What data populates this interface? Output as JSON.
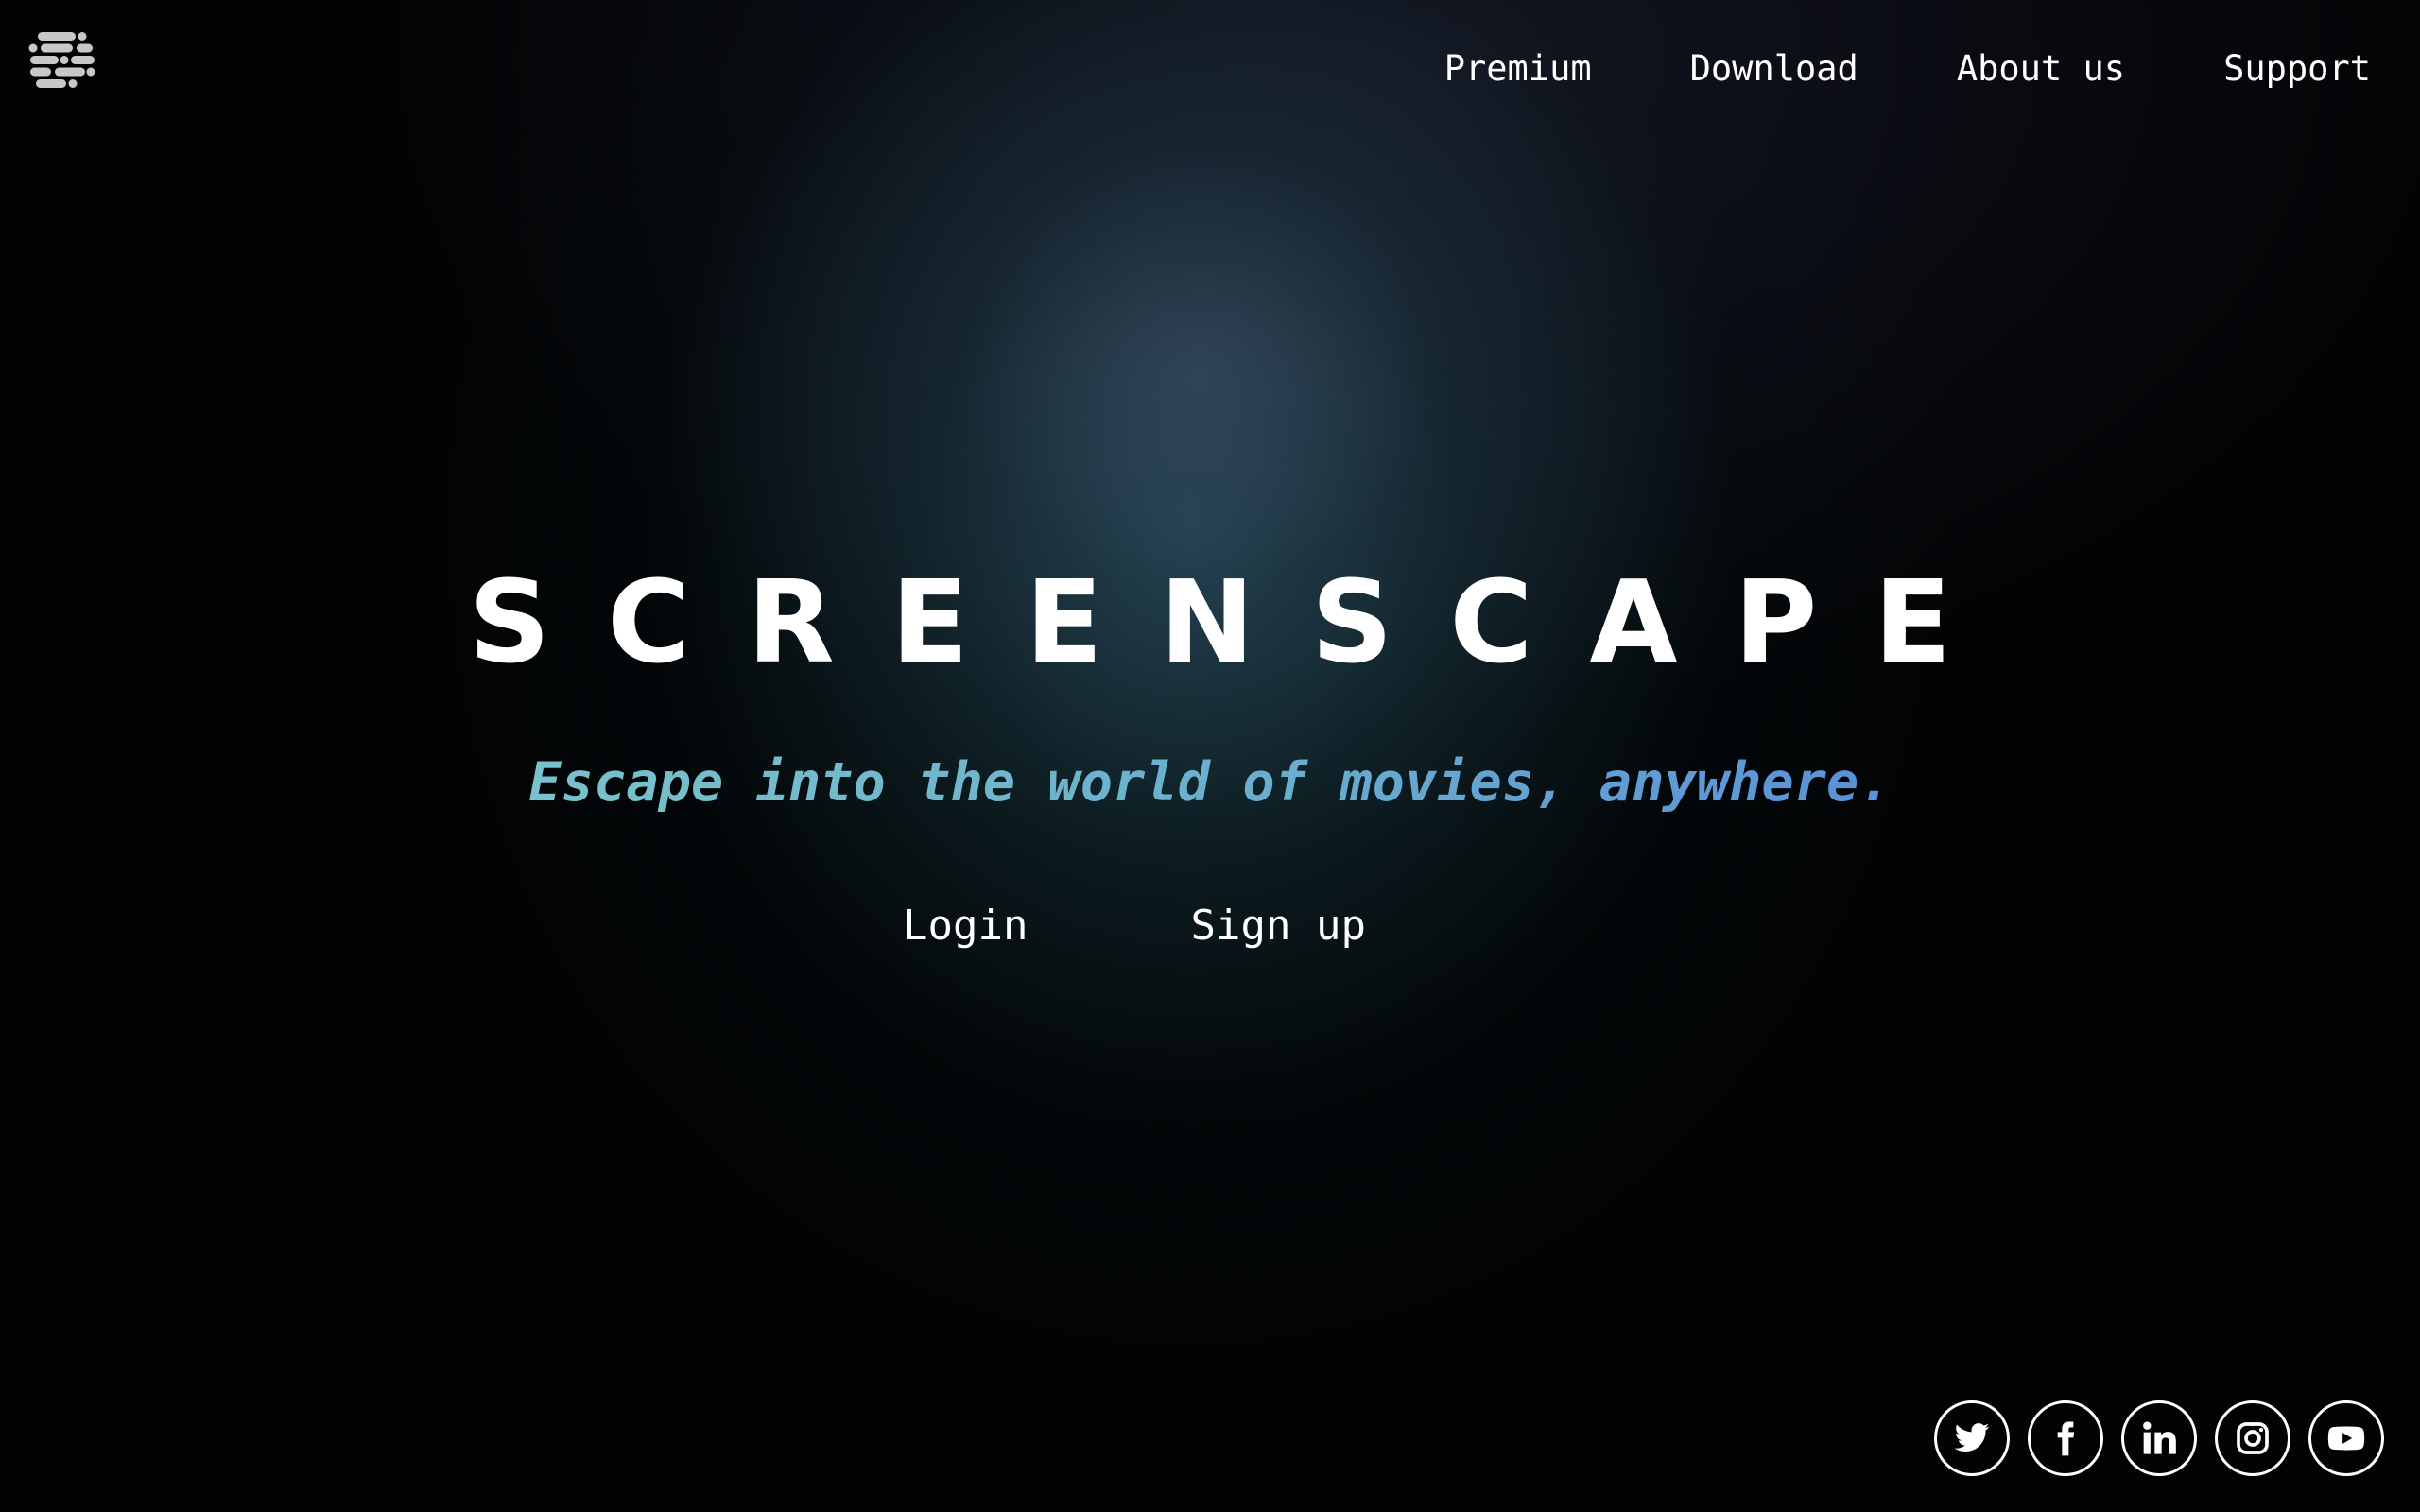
{
  "brand": {
    "title": "SCREENSCAPE",
    "logo_icon": "film-strip-logo-icon"
  },
  "nav": {
    "items": [
      {
        "label": "Premium"
      },
      {
        "label": "Download"
      },
      {
        "label": "About us"
      },
      {
        "label": "Support"
      }
    ]
  },
  "hero": {
    "tagline": "Escape into the world of movies, anywhere.",
    "login_label": "Login",
    "signup_label": "Sign up"
  },
  "social": [
    {
      "icon": "twitter-icon"
    },
    {
      "icon": "facebook-icon"
    },
    {
      "icon": "linkedin-icon"
    },
    {
      "icon": "instagram-icon"
    },
    {
      "icon": "youtube-icon"
    }
  ],
  "colors": {
    "background": "#020304",
    "glow_teal": "#264e5c",
    "tagline_start": "#79c2cc",
    "tagline_end": "#5a90d8",
    "text": "#ffffff"
  }
}
